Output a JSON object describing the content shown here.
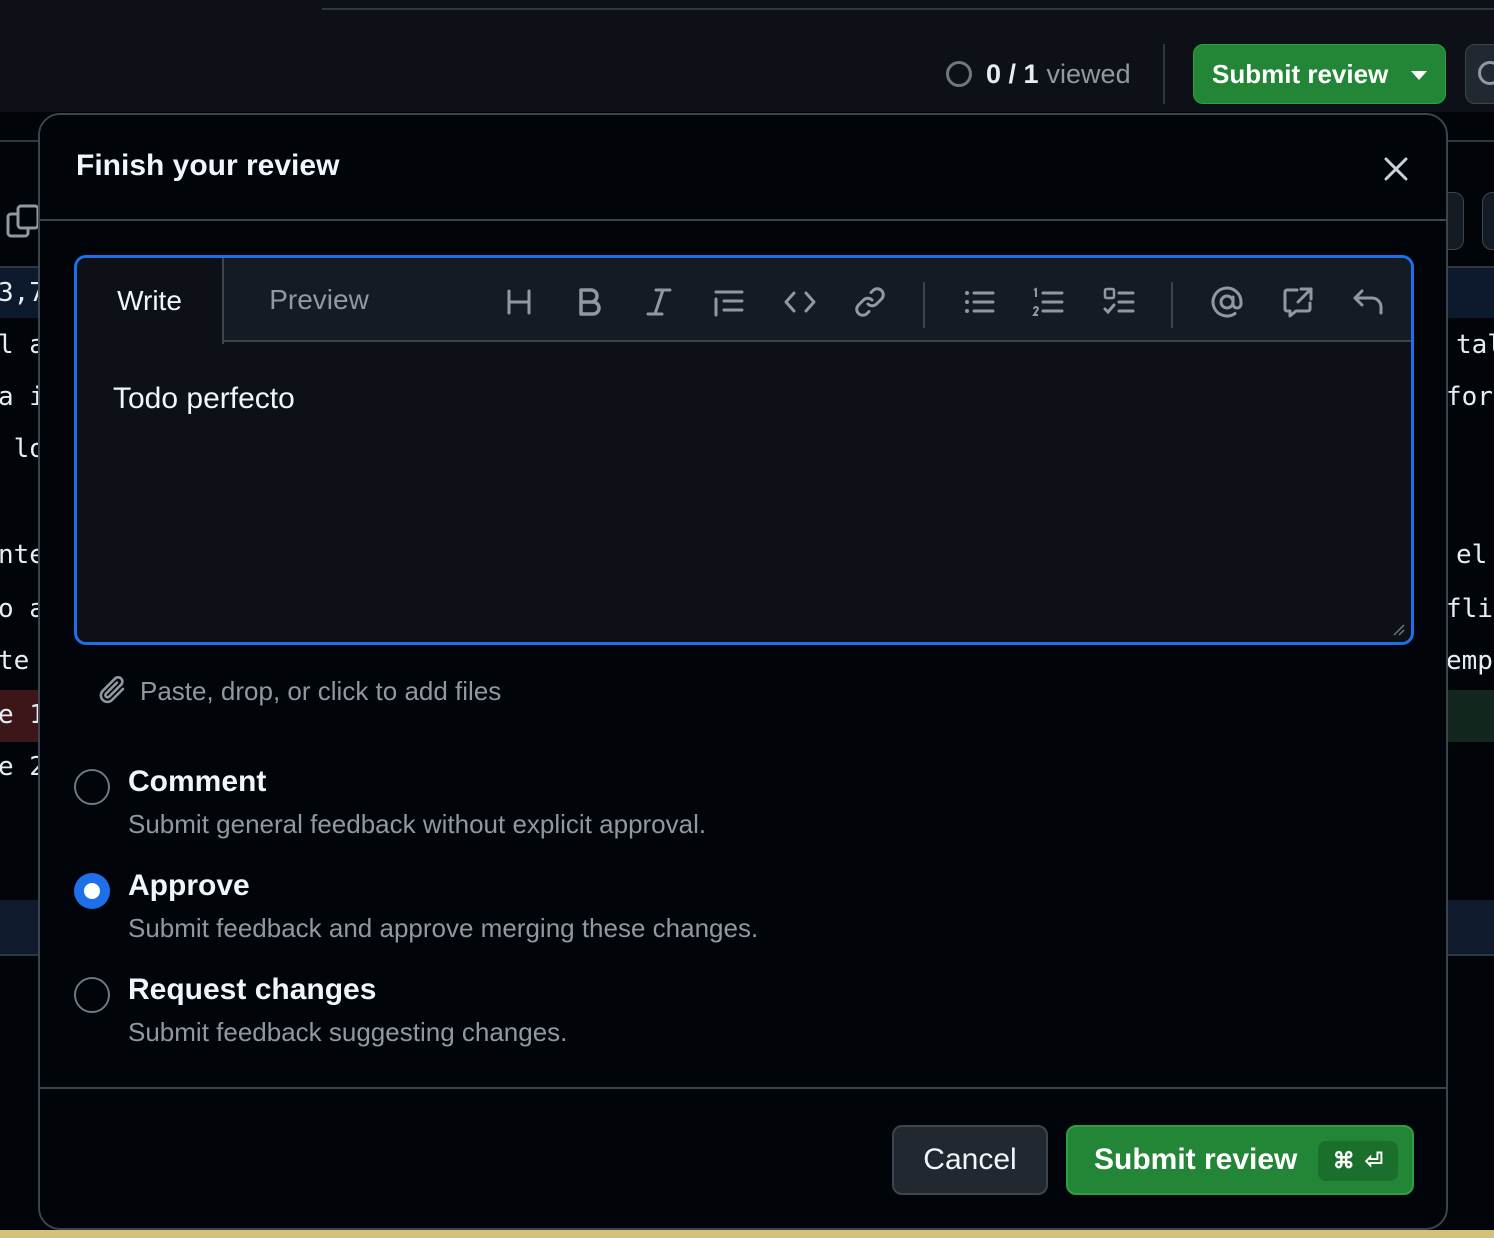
{
  "viewed": {
    "count": "0 / 1",
    "word": "viewed"
  },
  "header_submit": {
    "label": "Submit review"
  },
  "background_code": {
    "left": [
      "3,7",
      "l a",
      "a i",
      " lo",
      "nte",
      "o a",
      "te ",
      "e 1",
      "e 2"
    ],
    "right": [
      "tal",
      "for",
      "el",
      "flic",
      "empl"
    ]
  },
  "dialog": {
    "title": "Finish your review",
    "tabs": {
      "write": "Write",
      "preview": "Preview"
    },
    "toolbar_icons": [
      "heading-icon",
      "bold-icon",
      "italic-icon",
      "quote-icon",
      "code-icon",
      "link-icon",
      "unordered-list-icon",
      "ordered-list-icon",
      "task-list-icon",
      "mention-icon",
      "reference-icon",
      "undo-icon"
    ],
    "body_text": "Todo perfecto",
    "attach_text": "Paste, drop, or click to add files",
    "options": [
      {
        "label": "Comment",
        "description": "Submit general feedback without explicit approval.",
        "checked": false
      },
      {
        "label": "Approve",
        "description": "Submit feedback and approve merging these changes.",
        "checked": true
      },
      {
        "label": "Request changes",
        "description": "Submit feedback suggesting changes.",
        "checked": false
      }
    ],
    "cancel_label": "Cancel",
    "submit_label": "Submit review",
    "shortcut": {
      "modifier": "⌘",
      "key": "⏎"
    }
  },
  "colors": {
    "accent": "#1f6feb",
    "primary_button": "#238636",
    "background": "#010409"
  }
}
